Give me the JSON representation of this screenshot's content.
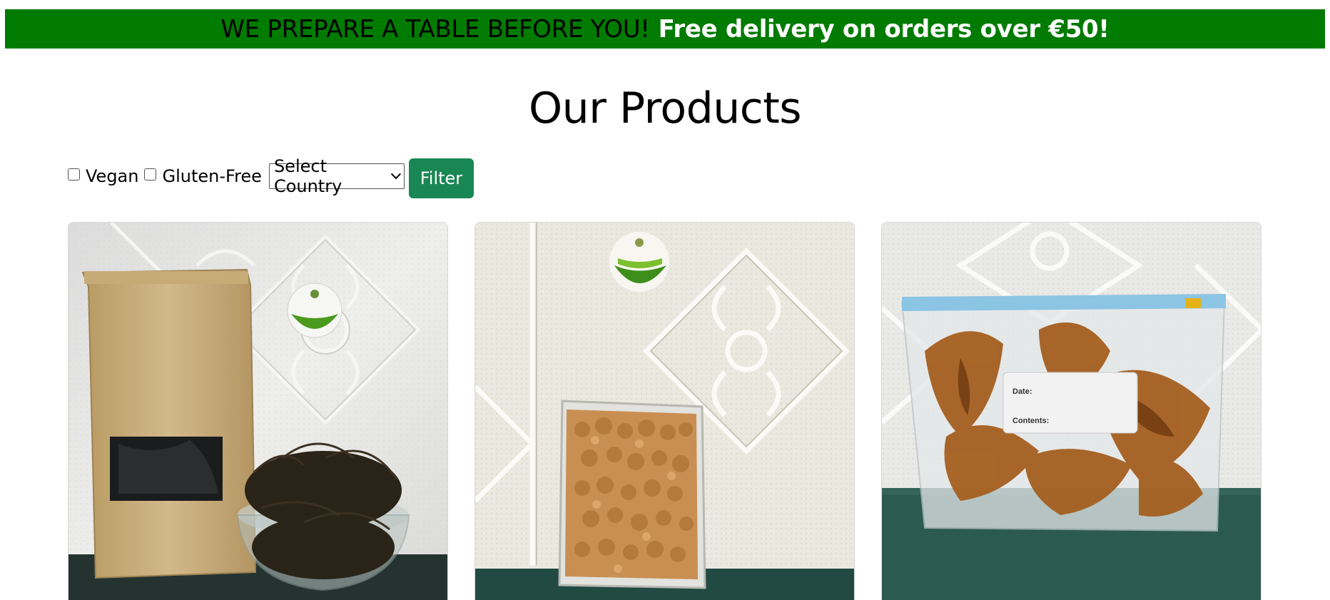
{
  "banner": {
    "message": "WE PREPARE A TABLE BEFORE YOU!",
    "promo": "Free delivery on orders over €50!",
    "background_color": "#017b01"
  },
  "page": {
    "title": "Our Products"
  },
  "filters": {
    "vegan_label": "Vegan",
    "vegan_checked": false,
    "gluten_free_label": "Gluten-Free",
    "gluten_free_checked": false,
    "country_select_value": "Select Country",
    "filter_button_label": "Filter",
    "button_color": "#198754"
  },
  "products": [
    {
      "image_subject": "kraft pouch with a glass bowl of dried dark leaves"
    },
    {
      "image_subject": "clear vacuum pack of tiger nuts"
    },
    {
      "image_subject": "zip-lock bag of dried fish"
    }
  ],
  "product_bag_label": {
    "date": "Date:",
    "contents": "Contents:"
  }
}
